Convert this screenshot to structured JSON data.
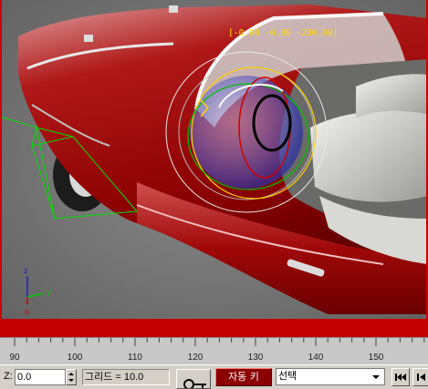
{
  "viewport": {
    "coord_readout": "[-0.00 -0.00 -230.00]",
    "axis_labels": {
      "z": "z",
      "y": "y",
      "x": "x"
    }
  },
  "timeline": {
    "ticks": [
      "90",
      "100",
      "110",
      "120",
      "130",
      "140",
      "150"
    ]
  },
  "statusbar": {
    "z_label": "Z:",
    "z_value": "0.0",
    "grid_text": "그리드 = 10.0",
    "auto_key_label": "자동 키",
    "selection_value": "선택"
  },
  "colors": {
    "auto_key_bg": "#8b0000",
    "viewport_border": "#cc0000",
    "readout": "#ffd800"
  }
}
